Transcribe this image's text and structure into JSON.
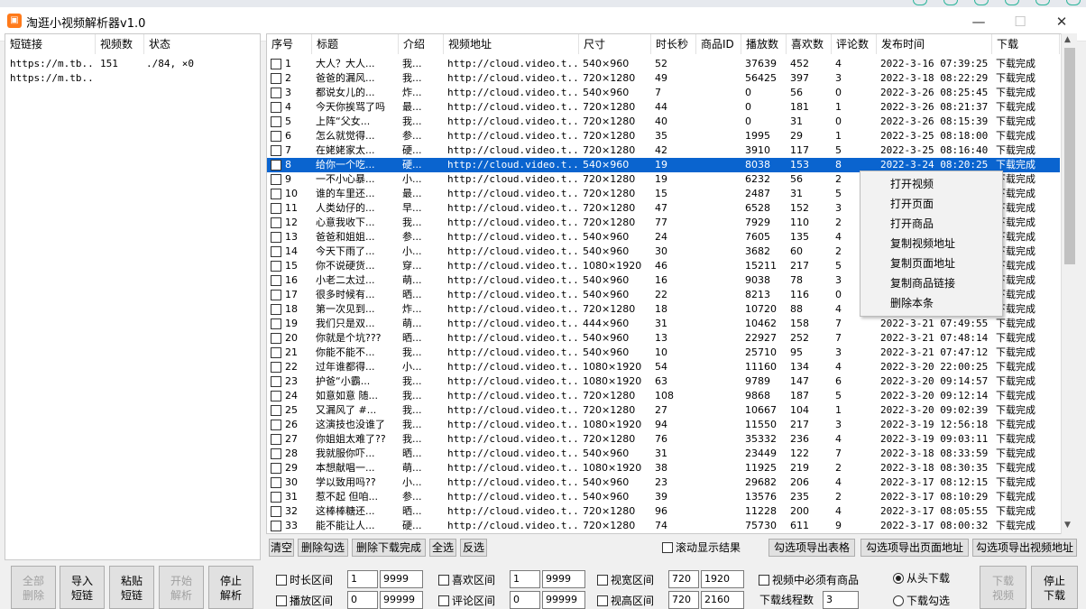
{
  "window": {
    "title": "淘逛小视频解析器v1.0",
    "icon": "app-logo-icon",
    "minimize": "—",
    "maximize": "☐",
    "close": "✕"
  },
  "left_table": {
    "headers": [
      "短链接",
      "视频数",
      "状态"
    ],
    "rows": [
      {
        "link": "https://m.tb...",
        "count": "151",
        "status": "./84, ×0"
      },
      {
        "link": "https://m.tb...",
        "count": "",
        "status": ""
      }
    ]
  },
  "main_table": {
    "headers": [
      "序号",
      "标题",
      "介绍",
      "视频地址",
      "尺寸",
      "时长秒",
      "商品ID",
      "播放数",
      "喜欢数",
      "评论数",
      "发布时间",
      "下载"
    ],
    "selected_index": 7,
    "rows": [
      {
        "no": "1",
        "title": "大人？大人...",
        "intro": "我...",
        "url": "http://cloud.video.t...",
        "size": "540×960",
        "dur": "52",
        "pid": "",
        "plays": "37639",
        "likes": "452",
        "comments": "4",
        "time": "2022-3-16 07:39:25",
        "dl": "下载完成"
      },
      {
        "no": "2",
        "title": "爸爸的漏风...",
        "intro": "我...",
        "url": "http://cloud.video.t...",
        "size": "720×1280",
        "dur": "49",
        "pid": "",
        "plays": "56425",
        "likes": "397",
        "comments": "3",
        "time": "2022-3-18 08:22:29",
        "dl": "下载完成"
      },
      {
        "no": "3",
        "title": "都说女儿的...",
        "intro": "炸...",
        "url": "http://cloud.video.t...",
        "size": "540×960",
        "dur": "7",
        "pid": "",
        "plays": "0",
        "likes": "56",
        "comments": "0",
        "time": "2022-3-26 08:25:45",
        "dl": "下载完成"
      },
      {
        "no": "4",
        "title": "今天你挨骂了吗",
        "intro": "最...",
        "url": "http://cloud.video.t...",
        "size": "720×1280",
        "dur": "44",
        "pid": "",
        "plays": "0",
        "likes": "181",
        "comments": "1",
        "time": "2022-3-26 08:21:37",
        "dl": "下载完成"
      },
      {
        "no": "5",
        "title": "上阵“父女...",
        "intro": "我...",
        "url": "http://cloud.video.t...",
        "size": "720×1280",
        "dur": "40",
        "pid": "",
        "plays": "0",
        "likes": "31",
        "comments": "0",
        "time": "2022-3-26 08:15:39",
        "dl": "下载完成"
      },
      {
        "no": "6",
        "title": "怎么就觉得...",
        "intro": "参...",
        "url": "http://cloud.video.t...",
        "size": "720×1280",
        "dur": "35",
        "pid": "",
        "plays": "1995",
        "likes": "29",
        "comments": "1",
        "time": "2022-3-25 08:18:00",
        "dl": "下载完成"
      },
      {
        "no": "7",
        "title": "在姥姥家太...",
        "intro": "硬...",
        "url": "http://cloud.video.t...",
        "size": "720×1280",
        "dur": "42",
        "pid": "",
        "plays": "3910",
        "likes": "117",
        "comments": "5",
        "time": "2022-3-25 08:16:40",
        "dl": "下载完成"
      },
      {
        "no": "8",
        "title": "给你一个吃...",
        "intro": "硬...",
        "url": "http://cloud.video.t...",
        "size": "540×960",
        "dur": "19",
        "pid": "",
        "plays": "8038",
        "likes": "153",
        "comments": "8",
        "time": "2022-3-24 08:20:25",
        "dl": "下载完成"
      },
      {
        "no": "9",
        "title": "一不小心暴...",
        "intro": "小...",
        "url": "http://cloud.video.t...",
        "size": "720×1280",
        "dur": "19",
        "pid": "",
        "plays": "6232",
        "likes": "56",
        "comments": "2",
        "time": "",
        "dl": "下载完成"
      },
      {
        "no": "10",
        "title": "谁的车里还...",
        "intro": "最...",
        "url": "http://cloud.video.t...",
        "size": "720×1280",
        "dur": "15",
        "pid": "",
        "plays": "2487",
        "likes": "31",
        "comments": "5",
        "time": "",
        "dl": "下载完成"
      },
      {
        "no": "11",
        "title": "人类幼仔的...",
        "intro": "早...",
        "url": "http://cloud.video.t...",
        "size": "720×1280",
        "dur": "47",
        "pid": "",
        "plays": "6528",
        "likes": "152",
        "comments": "3",
        "time": "",
        "dl": "下载完成"
      },
      {
        "no": "12",
        "title": "心意我收下...",
        "intro": "我...",
        "url": "http://cloud.video.t...",
        "size": "720×1280",
        "dur": "77",
        "pid": "",
        "plays": "7929",
        "likes": "110",
        "comments": "2",
        "time": "",
        "dl": "下载完成"
      },
      {
        "no": "13",
        "title": "爸爸和姐姐...",
        "intro": "参...",
        "url": "http://cloud.video.t...",
        "size": "540×960",
        "dur": "24",
        "pid": "",
        "plays": "7605",
        "likes": "135",
        "comments": "4",
        "time": "",
        "dl": "下载完成"
      },
      {
        "no": "14",
        "title": "今天下雨了...",
        "intro": "小...",
        "url": "http://cloud.video.t...",
        "size": "540×960",
        "dur": "30",
        "pid": "",
        "plays": "3682",
        "likes": "60",
        "comments": "2",
        "time": "",
        "dl": "下载完成"
      },
      {
        "no": "15",
        "title": "你不说硬货...",
        "intro": "穿...",
        "url": "http://cloud.video.t...",
        "size": "1080×1920",
        "dur": "46",
        "pid": "",
        "plays": "15211",
        "likes": "217",
        "comments": "5",
        "time": "",
        "dl": "下载完成"
      },
      {
        "no": "16",
        "title": "小老二太过...",
        "intro": "萌...",
        "url": "http://cloud.video.t...",
        "size": "540×960",
        "dur": "16",
        "pid": "",
        "plays": "9038",
        "likes": "78",
        "comments": "3",
        "time": "",
        "dl": "下载完成"
      },
      {
        "no": "17",
        "title": "很多时候有...",
        "intro": "晒...",
        "url": "http://cloud.video.t...",
        "size": "540×960",
        "dur": "22",
        "pid": "",
        "plays": "8213",
        "likes": "116",
        "comments": "0",
        "time": "",
        "dl": "下载完成"
      },
      {
        "no": "18",
        "title": "第一次见到...",
        "intro": "炸...",
        "url": "http://cloud.video.t...",
        "size": "720×1280",
        "dur": "18",
        "pid": "",
        "plays": "10720",
        "likes": "88",
        "comments": "4",
        "time": "",
        "dl": "下载完成"
      },
      {
        "no": "19",
        "title": "我们只是双...",
        "intro": "萌...",
        "url": "http://cloud.video.t...",
        "size": "444×960",
        "dur": "31",
        "pid": "",
        "plays": "10462",
        "likes": "158",
        "comments": "7",
        "time": "2022-3-21 07:49:55",
        "dl": "下载完成"
      },
      {
        "no": "20",
        "title": "你就是个坑???",
        "intro": "晒...",
        "url": "http://cloud.video.t...",
        "size": "540×960",
        "dur": "13",
        "pid": "",
        "plays": "22927",
        "likes": "252",
        "comments": "7",
        "time": "2022-3-21 07:48:14",
        "dl": "下载完成"
      },
      {
        "no": "21",
        "title": "你能不能不...",
        "intro": "我...",
        "url": "http://cloud.video.t...",
        "size": "540×960",
        "dur": "10",
        "pid": "",
        "plays": "25710",
        "likes": "95",
        "comments": "3",
        "time": "2022-3-21 07:47:12",
        "dl": "下载完成"
      },
      {
        "no": "22",
        "title": "过年谁都得...",
        "intro": "小...",
        "url": "http://cloud.video.t...",
        "size": "1080×1920",
        "dur": "54",
        "pid": "",
        "plays": "11160",
        "likes": "134",
        "comments": "4",
        "time": "2022-3-20 22:00:25",
        "dl": "下载完成"
      },
      {
        "no": "23",
        "title": "护爸“小霸...",
        "intro": "我...",
        "url": "http://cloud.video.t...",
        "size": "1080×1920",
        "dur": "63",
        "pid": "",
        "plays": "9789",
        "likes": "147",
        "comments": "6",
        "time": "2022-3-20 09:14:57",
        "dl": "下载完成"
      },
      {
        "no": "24",
        "title": "如意如意 随...",
        "intro": "我...",
        "url": "http://cloud.video.t...",
        "size": "720×1280",
        "dur": "108",
        "pid": "",
        "plays": "9868",
        "likes": "187",
        "comments": "5",
        "time": "2022-3-20 09:12:14",
        "dl": "下载完成"
      },
      {
        "no": "25",
        "title": "又漏风了 #...",
        "intro": "我...",
        "url": "http://cloud.video.t...",
        "size": "720×1280",
        "dur": "27",
        "pid": "",
        "plays": "10667",
        "likes": "104",
        "comments": "1",
        "time": "2022-3-20 09:02:39",
        "dl": "下载完成"
      },
      {
        "no": "26",
        "title": "这演技也没谁了",
        "intro": "我...",
        "url": "http://cloud.video.t...",
        "size": "1080×1920",
        "dur": "94",
        "pid": "",
        "plays": "11550",
        "likes": "217",
        "comments": "3",
        "time": "2022-3-19 12:56:18",
        "dl": "下载完成"
      },
      {
        "no": "27",
        "title": "你姐姐太难了??",
        "intro": "我...",
        "url": "http://cloud.video.t...",
        "size": "720×1280",
        "dur": "76",
        "pid": "",
        "plays": "35332",
        "likes": "236",
        "comments": "4",
        "time": "2022-3-19 09:03:11",
        "dl": "下载完成"
      },
      {
        "no": "28",
        "title": "我就服你吓...",
        "intro": "晒...",
        "url": "http://cloud.video.t...",
        "size": "540×960",
        "dur": "31",
        "pid": "",
        "plays": "23449",
        "likes": "122",
        "comments": "7",
        "time": "2022-3-18 08:33:59",
        "dl": "下载完成"
      },
      {
        "no": "29",
        "title": "本想献唱一...",
        "intro": "萌...",
        "url": "http://cloud.video.t...",
        "size": "1080×1920",
        "dur": "38",
        "pid": "",
        "plays": "11925",
        "likes": "219",
        "comments": "2",
        "time": "2022-3-18 08:30:35",
        "dl": "下载完成"
      },
      {
        "no": "30",
        "title": "学以致用吗??",
        "intro": "小...",
        "url": "http://cloud.video.t...",
        "size": "540×960",
        "dur": "23",
        "pid": "",
        "plays": "29682",
        "likes": "206",
        "comments": "4",
        "time": "2022-3-17 08:12:15",
        "dl": "下载完成"
      },
      {
        "no": "31",
        "title": "惹不起 但咱...",
        "intro": "参...",
        "url": "http://cloud.video.t...",
        "size": "540×960",
        "dur": "39",
        "pid": "",
        "plays": "13576",
        "likes": "235",
        "comments": "2",
        "time": "2022-3-17 08:10:29",
        "dl": "下载完成"
      },
      {
        "no": "32",
        "title": "这棒棒糖还...",
        "intro": "晒...",
        "url": "http://cloud.video.t...",
        "size": "720×1280",
        "dur": "96",
        "pid": "",
        "plays": "11228",
        "likes": "200",
        "comments": "4",
        "time": "2022-3-17 08:05:55",
        "dl": "下载完成"
      },
      {
        "no": "33",
        "title": "能不能让人...",
        "intro": "硬...",
        "url": "http://cloud.video.t...",
        "size": "720×1280",
        "dur": "74",
        "pid": "",
        "plays": "75730",
        "likes": "611",
        "comments": "9",
        "time": "2022-3-17 08:00:32",
        "dl": "下载完成"
      }
    ]
  },
  "context_menu": [
    "打开视频",
    "打开页面",
    "打开商品",
    "复制视频地址",
    "复制页面地址",
    "复制商品链接",
    "删除本条"
  ],
  "action_bar": {
    "clear": "清空",
    "delete_checked": "删除勾选",
    "delete_done": "删除下载完成",
    "select_all": "全选",
    "invert": "反选",
    "auto_scroll": "滚动显示结果",
    "export_table": "勾选项导出表格",
    "export_pages": "勾选项导出页面地址",
    "export_videos": "勾选项导出视频地址"
  },
  "left_buttons": [
    {
      "line1": "全部",
      "line2": "删除"
    },
    {
      "line1": "导入",
      "line2": "短链"
    },
    {
      "line1": "粘贴",
      "line2": "短链"
    },
    {
      "line1": "开始",
      "line2": "解析"
    },
    {
      "line1": "停止",
      "line2": "解析"
    }
  ],
  "filters": {
    "duration": {
      "label": "时长区间",
      "min": "1",
      "max": "9999"
    },
    "likes": {
      "label": "喜欢区间",
      "min": "1",
      "max": "9999"
    },
    "width": {
      "label": "视宽区间",
      "min": "720",
      "max": "1920"
    },
    "plays": {
      "label": "播放区间",
      "min": "0",
      "max": "99999"
    },
    "comments": {
      "label": "评论区间",
      "min": "0",
      "max": "99999"
    },
    "height": {
      "label": "视高区间",
      "min": "720",
      "max": "2160"
    },
    "must_product": "视频中必须有商品",
    "threads_label": "下载线程数",
    "threads": "3",
    "radio_head": "从头下载",
    "radio_checked": "下载勾选"
  },
  "right_buttons": {
    "download": {
      "line1": "下载",
      "line2": "视频"
    },
    "stop": {
      "line1": "停止",
      "line2": "下载"
    }
  },
  "colors": {
    "selection": "#0a64cf",
    "accent": "#ff7a1a"
  }
}
